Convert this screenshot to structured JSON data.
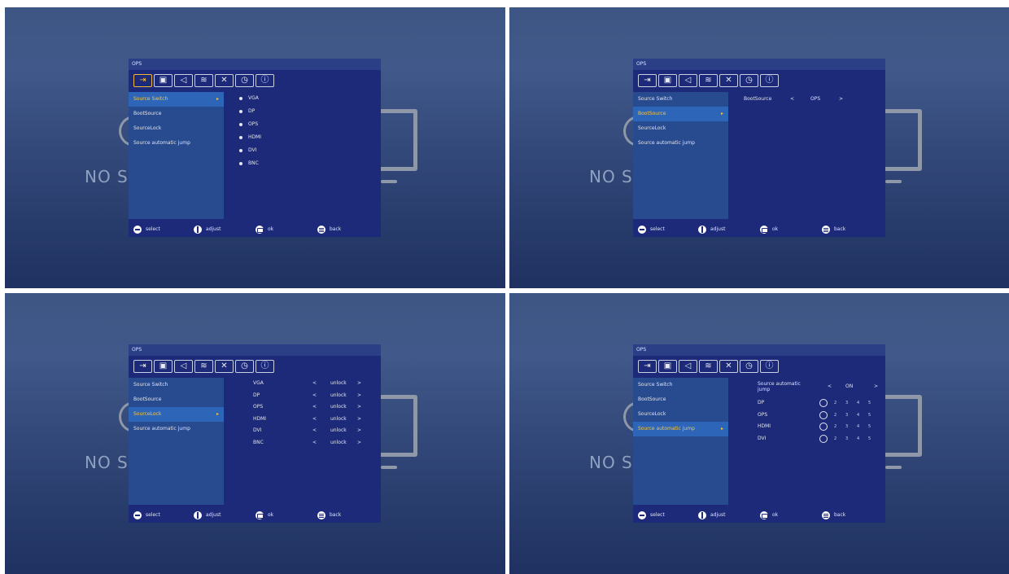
{
  "background": {
    "no_signal_text": "NO S"
  },
  "menu": {
    "title": "OPS",
    "tabs": [
      {
        "icon": "input-source-icon",
        "glyph": "⇥"
      },
      {
        "icon": "picture-icon",
        "glyph": "▣"
      },
      {
        "icon": "sound-icon",
        "glyph": "◁"
      },
      {
        "icon": "wifi-icon",
        "glyph": "≋"
      },
      {
        "icon": "tools-icon",
        "glyph": "✕"
      },
      {
        "icon": "clock-icon",
        "glyph": "◷"
      },
      {
        "icon": "info-icon",
        "glyph": "ⓘ"
      }
    ],
    "left_items": [
      "Source Switch",
      "BootSource",
      "SourceLock",
      "Source automatic jump"
    ],
    "selected_arrow": "▸",
    "footer": {
      "select": "select",
      "adjust": "adjust",
      "ok": "ok",
      "back": "back"
    }
  },
  "panels": [
    {
      "selected_index": 0,
      "sources": [
        "VGA",
        "DP",
        "OPS",
        "HDMI",
        "DVI",
        "BNC"
      ]
    },
    {
      "selected_index": 1,
      "boot": {
        "label": "BootSource",
        "left": "<",
        "value": "OPS",
        "right": ">"
      }
    },
    {
      "selected_index": 2,
      "locks": [
        {
          "label": "VGA",
          "left": "<",
          "value": "unlock",
          "right": ">"
        },
        {
          "label": "DP",
          "left": "<",
          "value": "unlock",
          "right": ">"
        },
        {
          "label": "OPS",
          "left": "<",
          "value": "unlock",
          "right": ">"
        },
        {
          "label": "HDMI",
          "left": "<",
          "value": "unlock",
          "right": ">"
        },
        {
          "label": "DVI",
          "left": "<",
          "value": "unlock",
          "right": ">"
        },
        {
          "label": "BNC",
          "left": "<",
          "value": "unlock",
          "right": ">"
        }
      ]
    },
    {
      "selected_index": 3,
      "jump": {
        "label": "Source automatic jump",
        "left": "<",
        "value": "ON",
        "right": ">",
        "rows": [
          {
            "label": "DP",
            "numbers": [
              "2",
              "3",
              "4",
              "5"
            ]
          },
          {
            "label": "OPS",
            "numbers": [
              "2",
              "3",
              "4",
              "5"
            ]
          },
          {
            "label": "HDMI",
            "numbers": [
              "2",
              "3",
              "4",
              "5"
            ]
          },
          {
            "label": "DVI",
            "numbers": [
              "2",
              "3",
              "4",
              "5"
            ]
          }
        ]
      }
    }
  ]
}
